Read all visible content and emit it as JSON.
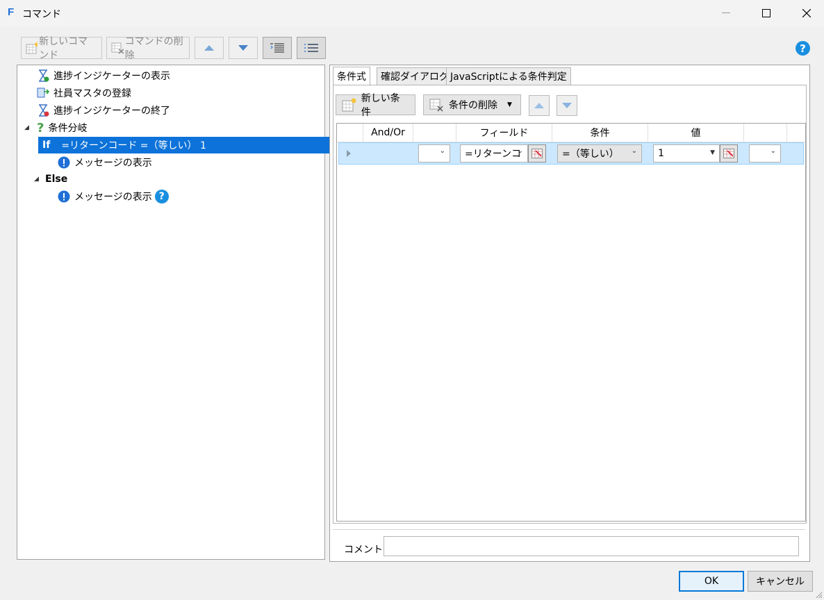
{
  "window": {
    "title": "コマンド",
    "app_icon_letter": "F"
  },
  "toolbar": {
    "new_command": "新しいコマンド",
    "delete_command": "コマンドの削除"
  },
  "tree": {
    "items": [
      {
        "label": "進捗インジケーターの表示"
      },
      {
        "label": "社員マスタの登録"
      },
      {
        "label": "進捗インジケーターの終了"
      },
      {
        "label": "条件分岐"
      },
      {
        "keyword": "If",
        "label": "=リターンコード =（等しい） 1"
      },
      {
        "label": "メッセージの表示"
      },
      {
        "keyword": "Else"
      },
      {
        "label": "メッセージの表示"
      }
    ]
  },
  "tabs": [
    "条件式",
    "確認ダイアログ",
    "JavaScriptによる条件判定"
  ],
  "condition_toolbar": {
    "new_condition": "新しい条件",
    "delete_condition": "条件の削除"
  },
  "grid": {
    "headers": [
      "And/Or",
      "フィールド",
      "条件",
      "値"
    ],
    "row": {
      "andor": "",
      "field": "=リターンコ",
      "operator": "=（等しい）",
      "value": "1",
      "extra": ""
    }
  },
  "comment": {
    "label": "コメント",
    "value": ""
  },
  "buttons": {
    "ok": "OK",
    "cancel": "キャンセル"
  },
  "colors": {
    "selection": "#0d72d9",
    "help": "#1a8fe0",
    "info": "#1f6fd6"
  }
}
